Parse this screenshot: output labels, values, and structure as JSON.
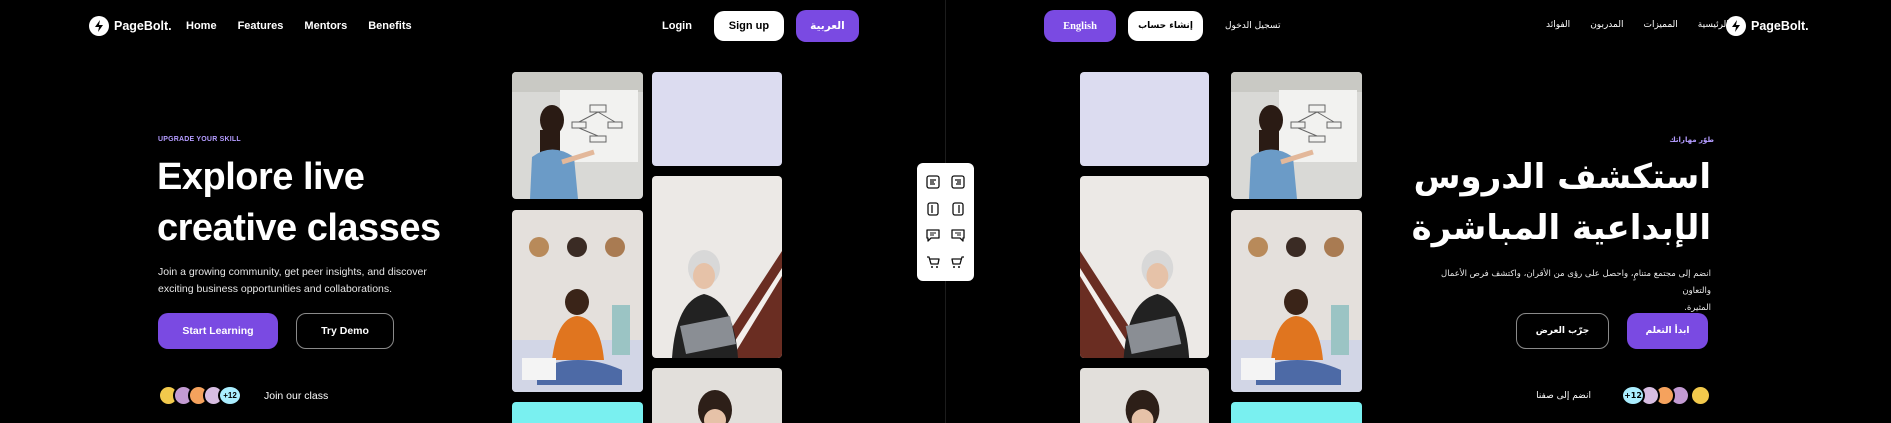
{
  "brand": {
    "name": "PageBolt."
  },
  "en": {
    "nav": [
      "Home",
      "Features",
      "Mentors",
      "Benefits"
    ],
    "login": "Login",
    "signup": "Sign up",
    "lang_switch": "العربية",
    "eyebrow": "UPGRADE YOUR SKILL",
    "headline_1": "Explore live",
    "headline_2": "creative classes",
    "sub_1": "Join a growing community, get peer insights, and discover",
    "sub_2": "exciting business opportunities and collaborations.",
    "cta_primary": "Start Learning",
    "cta_secondary": "Try Demo",
    "avatar_count": "+12",
    "join": "Join our class"
  },
  "ar": {
    "nav": [
      "الرئيسية",
      "المميزات",
      "المدربون",
      "الفوائد"
    ],
    "login": "تسجيل الدخول",
    "signup": "إنشاء حساب",
    "lang_switch": "English",
    "eyebrow": "طوّر مهاراتك",
    "headline_1": "استكشف الدروس",
    "headline_2": "الإبداعية المباشرة",
    "sub_1": "انضم إلى مجتمع متنامٍ، واحصل على رؤى من الأقران، واكتشف فرص الأعمال والتعاون",
    "sub_2": "المثيرة.",
    "cta_primary": "ابدأ التعلم",
    "cta_secondary": "جرّب العرض",
    "avatar_count": "12+",
    "join": "انضم إلى صفنا"
  },
  "toolbar_icons": [
    "align-left-icon",
    "align-right-icon",
    "panel-left-icon",
    "panel-right-icon",
    "chat-left-icon",
    "chat-right-icon",
    "cart-left-icon",
    "cart-right-icon"
  ],
  "colors": {
    "accent": "#7a4ae2",
    "eyebrow": "#b49cff",
    "tile_lavender": "#dcdcf0",
    "tile_cyan": "#79f0f0"
  }
}
